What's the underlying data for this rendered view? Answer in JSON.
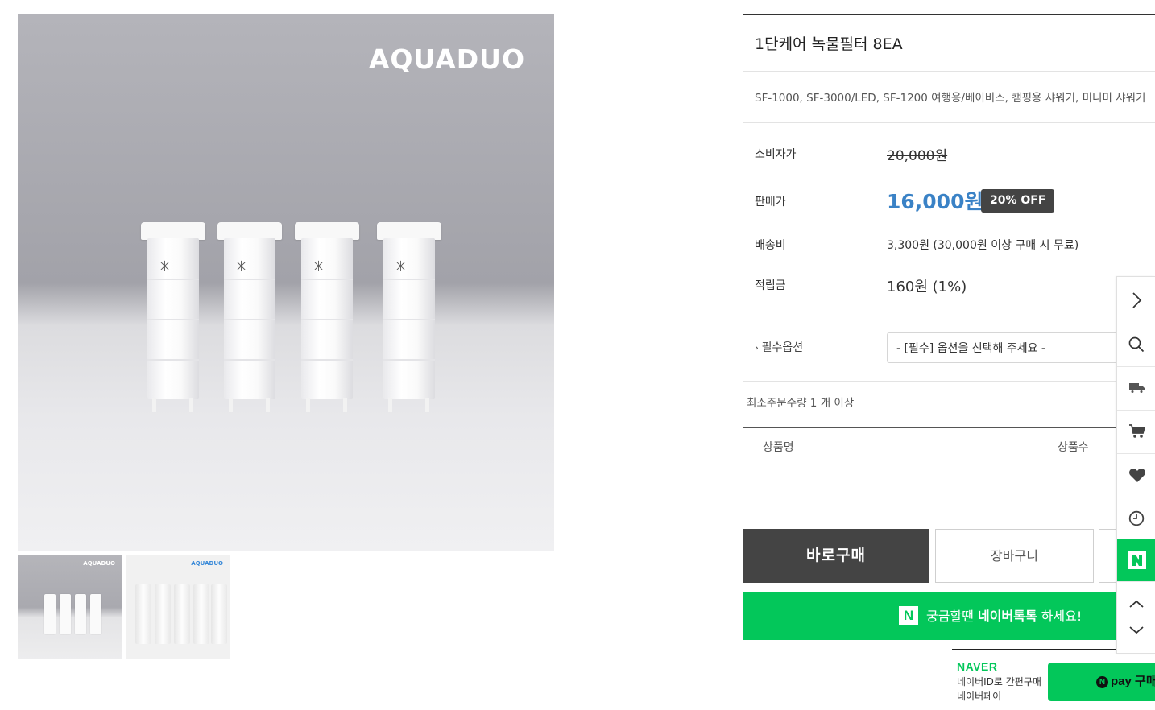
{
  "gallery": {
    "brand_logo": "AQUADUO",
    "thumb_logos": [
      "AQUADUO",
      "AQUADUO"
    ]
  },
  "product": {
    "title": "1단케어 녹물필터 8EA",
    "summary": "SF-1000, SF-3000/LED, SF-1200 여행용/베이비스, 캠핑용 샤워기, 미니미 샤워기",
    "consumer_price_label": "소비자가",
    "consumer_price": "20,000원",
    "sale_price_label": "판매가",
    "sale_price": "16,000원",
    "discount_badge": "20% OFF",
    "shipping_label": "배송비",
    "shipping_value": "3,300원 (30,000원 이상 구매 시 무료)",
    "points_label": "적립금",
    "points_value": "160원 (1%)",
    "option_label": "필수옵션",
    "option_placeholder": "- [필수] 옵션을 선택해 주세요 -",
    "min_order": "최소주문수량 1 개 이상",
    "table_headers": [
      "상품명",
      "상품수"
    ]
  },
  "actions": {
    "buy_now": "바로구매",
    "cart": "장바구니",
    "talk_prefix": "궁금할땐",
    "talk_bold": "네이버톡톡",
    "talk_suffix": "하세요!",
    "talk_badge": "N"
  },
  "naver_pay": {
    "logo": "NAVER",
    "line1": "네이버ID로 간편구매",
    "line2": "네이버페이",
    "button_badge": "N",
    "button_label": "pay 구매"
  },
  "quick_menu": {
    "items": [
      "chevron-right-icon",
      "search-icon",
      "truck-icon",
      "cart-icon",
      "heart-icon",
      "clock-icon",
      "naver-n-icon",
      "chevron-up-icon",
      "chevron-down-icon"
    ],
    "naver_badge": "N"
  },
  "colors": {
    "accent_price": "#3a82c6",
    "naver_green": "#03c75a",
    "dark_button": "#444444"
  }
}
